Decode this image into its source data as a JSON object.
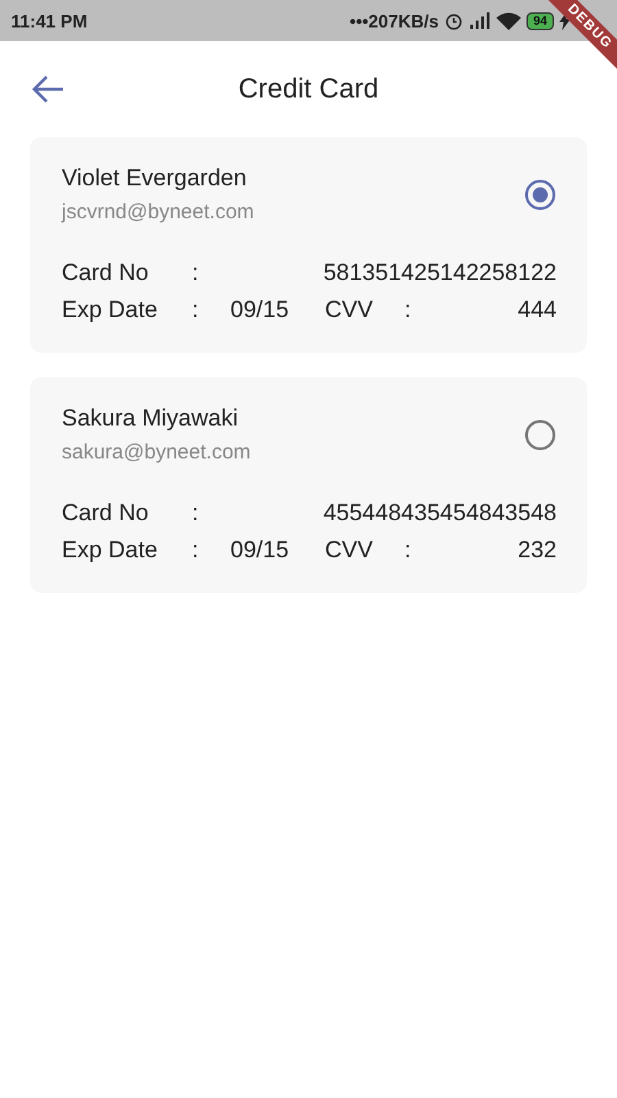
{
  "status_bar": {
    "time": "11:41 PM",
    "speed": "•••207KB/s",
    "battery": "94"
  },
  "debug_banner": "DEBUG",
  "app_bar": {
    "title": "Credit Card"
  },
  "cards": [
    {
      "name": "Violet Evergarden",
      "email": "jscvrnd@byneet.com",
      "selected": true,
      "card_no_label": "Card No",
      "card_no": "581351425142258122",
      "exp_label": "Exp Date",
      "exp": "09/15",
      "cvv_label": "CVV",
      "cvv": "444"
    },
    {
      "name": "Sakura Miyawaki",
      "email": "sakura@byneet.com",
      "selected": false,
      "card_no_label": "Card No",
      "card_no": "455448435454843548",
      "exp_label": "Exp Date",
      "exp": "09/15",
      "cvv_label": "CVV",
      "cvv": "232"
    }
  ],
  "separator": ":"
}
